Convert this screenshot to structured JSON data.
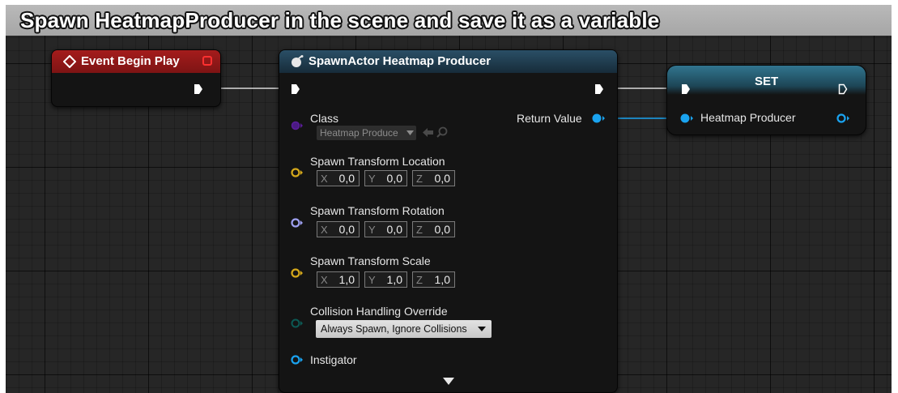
{
  "comment": {
    "text": "Spawn HeatmapProducer in the scene and save it as a variable"
  },
  "colors": {
    "event_header": "#8e1616",
    "spawn_header": "#1f3a4d",
    "set_header": "#2f6e86",
    "exec_wire": "#d8d8d8",
    "object_pin": "#1aa3f0",
    "class_pin": "#5b1d9a",
    "vector_pin": "#d6a91b",
    "rotator_pin": "#9ea0f0",
    "enum_pin": "#0c5a55"
  },
  "event_node": {
    "title": "Event Begin Play",
    "icon": "event-diamond-icon",
    "delegate_icon": "delegate-square-icon"
  },
  "spawn_node": {
    "title": "SpawnActor Heatmap Producer",
    "icon": "spawn-actor-icon",
    "class_label": "Class",
    "class_value": "Heatmap Produce",
    "return_label": "Return Value",
    "location": {
      "label": "Spawn Transform Location",
      "x": "0,0",
      "y": "0,0",
      "z": "0,0"
    },
    "rotation": {
      "label": "Spawn Transform Rotation",
      "x": "0,0",
      "y": "0,0",
      "z": "0,0"
    },
    "scale": {
      "label": "Spawn Transform Scale",
      "x": "1,0",
      "y": "1,0",
      "z": "1,0"
    },
    "collision": {
      "label": "Collision Handling Override",
      "value": "Always Spawn, Ignore Collisions"
    },
    "instigator_label": "Instigator",
    "axis_labels": {
      "x": "X",
      "y": "Y",
      "z": "Z"
    }
  },
  "set_node": {
    "title": "SET",
    "var_label": "Heatmap Producer"
  }
}
